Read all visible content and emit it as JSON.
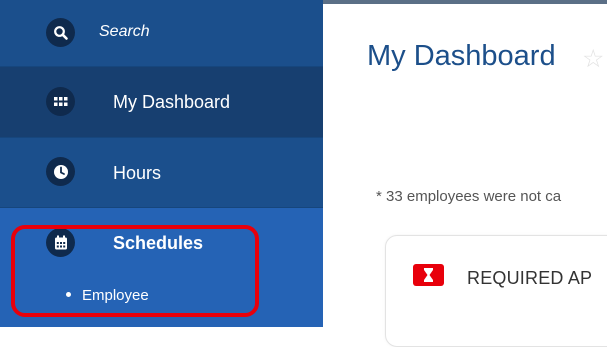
{
  "sidebar": {
    "search_placeholder": "Search",
    "items": [
      {
        "label": "My Dashboard",
        "icon": "grid-icon"
      },
      {
        "label": "Hours",
        "icon": "clock-icon"
      },
      {
        "label": "Schedules",
        "icon": "calendar-icon",
        "subitems": [
          "Employee"
        ]
      }
    ]
  },
  "main": {
    "title": "My Dashboard",
    "note": "* 33 employees were not ca",
    "card_title": "REQUIRED AP"
  },
  "colors": {
    "sidebar": "#1b4f8c",
    "sidebar_active": "#2563b5",
    "highlight": "#e8000b",
    "title": "#1c4f8a"
  }
}
